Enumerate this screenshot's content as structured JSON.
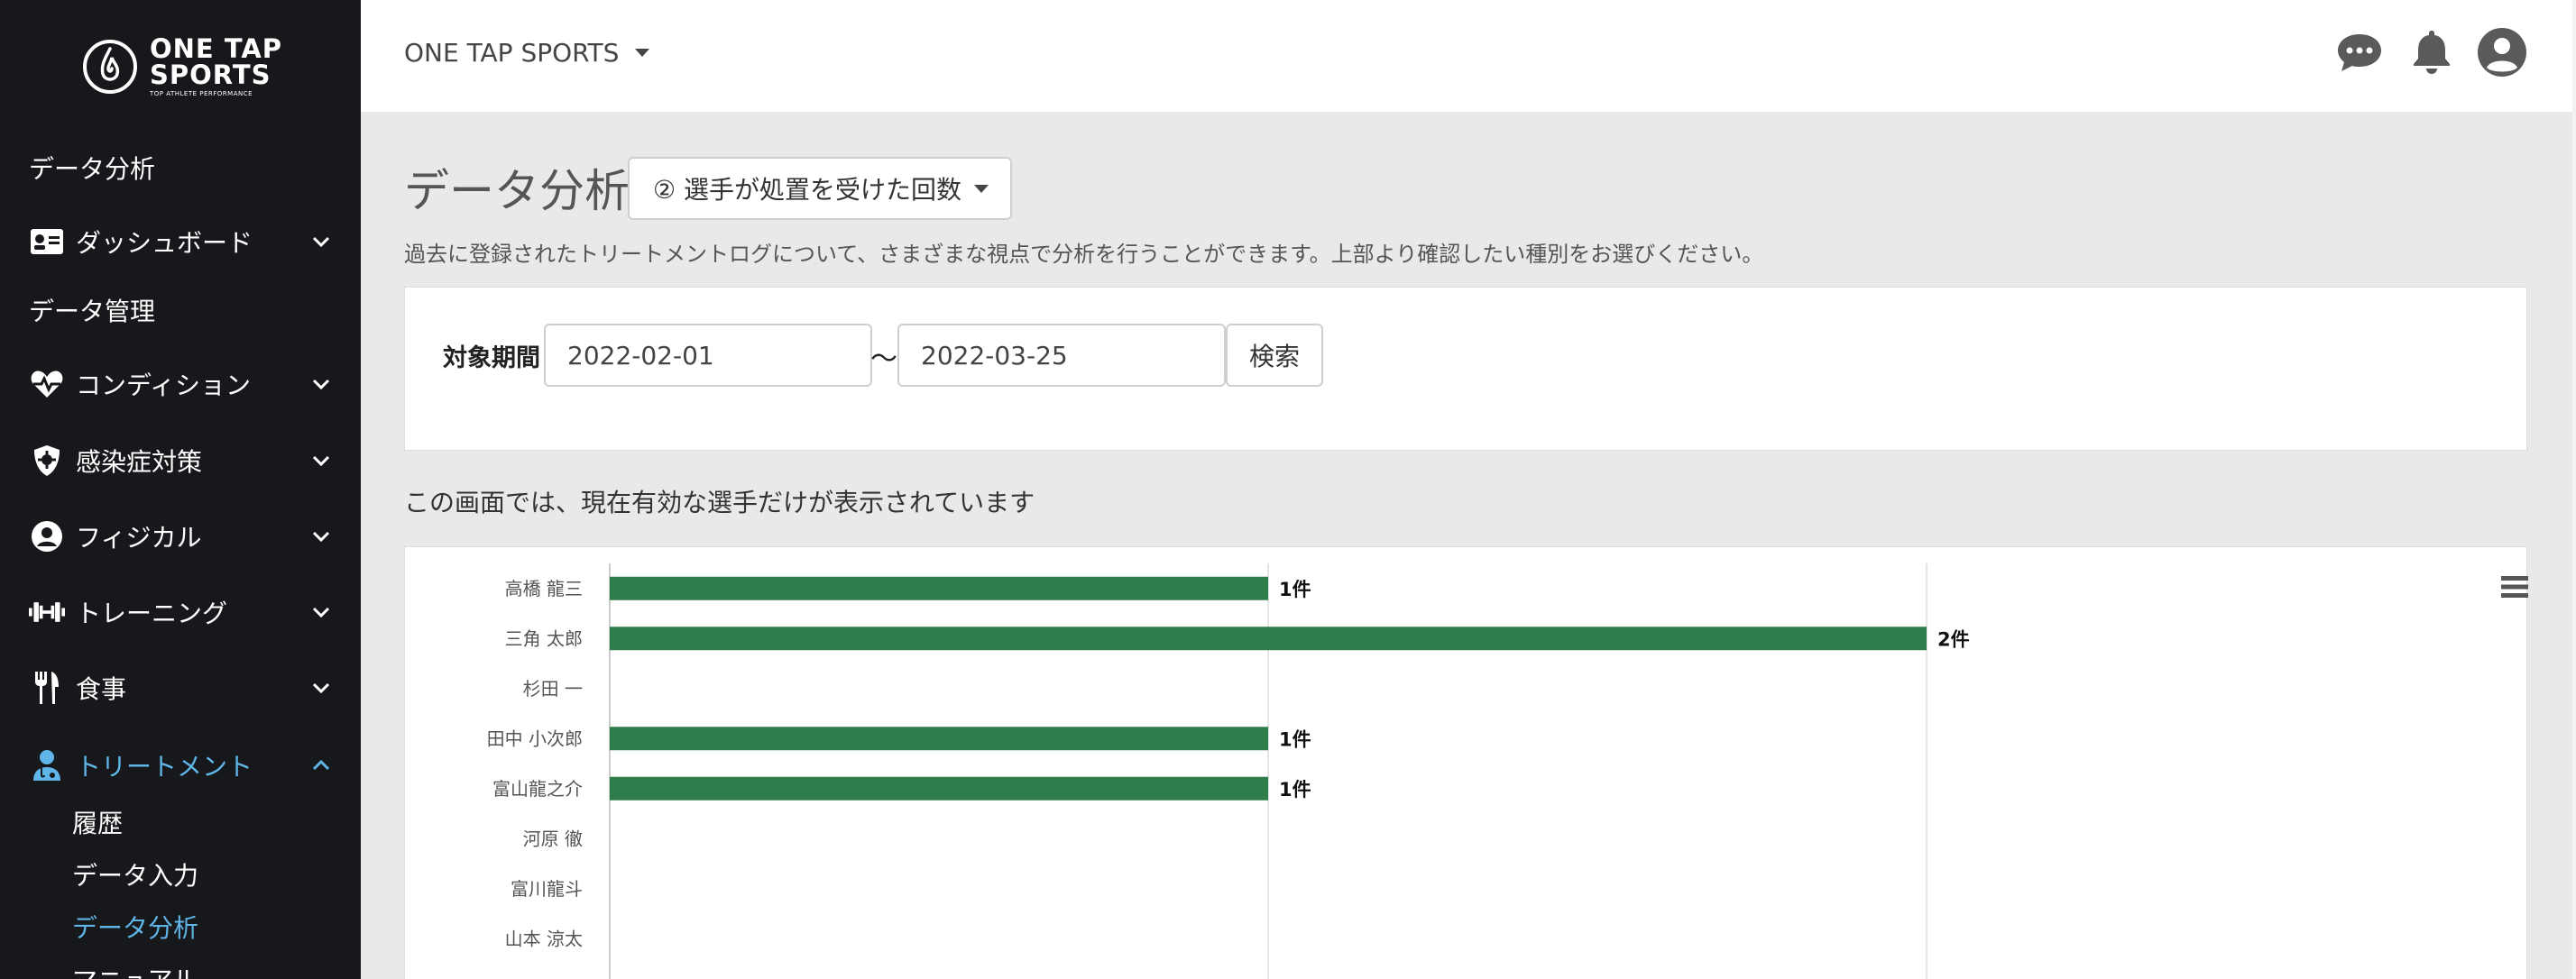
{
  "brand": {
    "line1": "ONE TAP",
    "line2": "SPORTS",
    "tagline": "TOP ATHLETE PERFORMANCE"
  },
  "sidebar": {
    "items": [
      {
        "label": "データ分析",
        "icon": "",
        "chevron": "",
        "active": false
      },
      {
        "label": "ダッシュボード",
        "icon": "id-card-icon",
        "chevron": "down",
        "active": false
      },
      {
        "label": "データ管理",
        "icon": "",
        "chevron": "",
        "active": false
      },
      {
        "label": "コンディション",
        "icon": "heartbeat-icon",
        "chevron": "down",
        "active": false
      },
      {
        "label": "感染症対策",
        "icon": "shield-virus-icon",
        "chevron": "down",
        "active": false
      },
      {
        "label": "フィジカル",
        "icon": "user-circle-icon",
        "chevron": "down",
        "active": false
      },
      {
        "label": "トレーニング",
        "icon": "dumbbell-icon",
        "chevron": "down",
        "active": false
      },
      {
        "label": "食事",
        "icon": "utensils-icon",
        "chevron": "down",
        "active": false
      },
      {
        "label": "トリートメント",
        "icon": "user-medic-icon",
        "chevron": "up",
        "active": true
      }
    ],
    "subitems": [
      {
        "label": "履歴",
        "active": false
      },
      {
        "label": "データ入力",
        "active": false
      },
      {
        "label": "データ分析",
        "active": true
      },
      {
        "label": "マニュアル",
        "active": false
      }
    ]
  },
  "header": {
    "team_name": "ONE TAP SPORTS",
    "icons": [
      "chat-icon",
      "bell-icon",
      "user-avatar-icon"
    ]
  },
  "main": {
    "title": "データ分析",
    "analysis_type": "② 選手が処置を受けた回数",
    "description": "過去に登録されたトリートメントログについて、さまざまな視点で分析を行うことができます。上部より確認したい種別をお選びください。",
    "filter": {
      "period_label": "対象期間",
      "start_date": "2022-02-01",
      "separator": "〜",
      "end_date": "2022-03-25",
      "search_label": "検索"
    },
    "notice": "この画面では、現在有効な選手だけが表示されています"
  },
  "colors": {
    "sidebar_bg": "#17181b",
    "accent": "#5fb5e8",
    "bar": "#2e7d4a"
  },
  "chart_data": {
    "type": "bar",
    "orientation": "horizontal",
    "categories": [
      "高橋 龍三",
      "三角 太郎",
      "杉田 一",
      "田中 小次郎",
      "富山龍之介",
      "河原 徹",
      "富川龍斗",
      "山本 涼太"
    ],
    "values": [
      1,
      2,
      0,
      1,
      1,
      0,
      0,
      0
    ],
    "data_labels": [
      "1件",
      "2件",
      "",
      "1件",
      "1件",
      "",
      "",
      ""
    ],
    "xlim": [
      0,
      2
    ],
    "grid": true
  }
}
